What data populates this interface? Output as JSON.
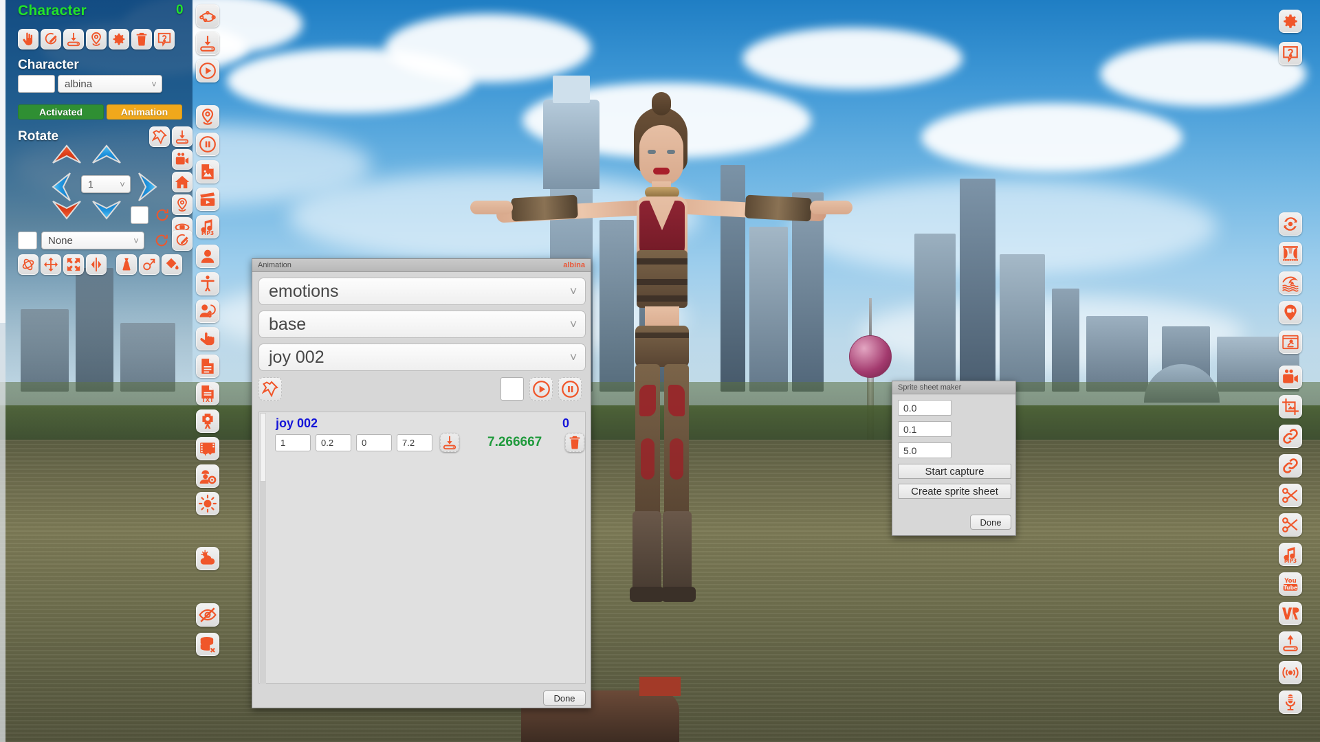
{
  "app": {
    "scene_name": "shanghai-skyline-background",
    "character_name": "albina"
  },
  "left_panel": {
    "title": "Character",
    "count": "0",
    "section_label": "Character",
    "character_value": "albina",
    "activated_label": "Activated",
    "animation_label": "Animation",
    "rotate_label": "Rotate",
    "rotate_step": "1",
    "morph_value": "None",
    "toolbar_icons": [
      {
        "name": "select-hand-icon"
      },
      {
        "name": "edit-pencil-icon"
      },
      {
        "name": "save-download-icon"
      },
      {
        "name": "place-marker-icon"
      },
      {
        "name": "settings-gear-icon"
      },
      {
        "name": "delete-trash-icon"
      },
      {
        "name": "help-question-icon"
      }
    ],
    "side_icons": [
      {
        "name": "pin-icon"
      },
      {
        "name": "save-download-icon"
      },
      {
        "name": "video-camera-icon"
      },
      {
        "name": "home-icon"
      },
      {
        "name": "place-marker-icon"
      },
      {
        "name": "orbit-camera-icon"
      },
      {
        "name": "reload-icon"
      },
      {
        "name": "edit-pencil-icon"
      }
    ],
    "transform_icons": [
      {
        "name": "rotate-3d-icon"
      },
      {
        "name": "move-icon"
      },
      {
        "name": "scale-icon"
      },
      {
        "name": "mirror-icon"
      },
      {
        "name": "clothing-dress-icon"
      },
      {
        "name": "attach-object-icon"
      },
      {
        "name": "paint-bucket-icon"
      }
    ]
  },
  "tool_rail": {
    "icons": [
      {
        "name": "path-nodes-icon"
      },
      {
        "name": "save-download-icon"
      },
      {
        "name": "play-circle-icon"
      },
      {
        "name": "place-marker-icon"
      },
      {
        "name": "pause-circle-icon"
      },
      {
        "name": "image-file-icon"
      },
      {
        "name": "clapperboard-icon"
      },
      {
        "name": "mp3-music-icon"
      },
      {
        "name": "avatar-person-icon"
      },
      {
        "name": "pose-figure-icon"
      },
      {
        "name": "character-swap-icon"
      },
      {
        "name": "hand-gesture-icon"
      },
      {
        "name": "document-icon"
      },
      {
        "name": "text-file-txt-icon"
      },
      {
        "name": "target-aim-icon"
      },
      {
        "name": "film-effects-icon"
      },
      {
        "name": "worker-settings-icon"
      },
      {
        "name": "sun-light-icon"
      },
      {
        "name": "weather-cloud-icon"
      },
      {
        "name": "hide-eye-icon"
      },
      {
        "name": "delete-database-icon"
      }
    ]
  },
  "right_rail": {
    "icons": [
      {
        "name": "settings-gear-icon"
      },
      {
        "name": "help-question-icon"
      },
      {
        "name": "refresh-sync-icon"
      },
      {
        "name": "stage-curtain-icon"
      },
      {
        "name": "water-wave-icon"
      },
      {
        "name": "video-location-icon"
      },
      {
        "name": "animation-run-icon"
      },
      {
        "name": "video-camera-icon"
      },
      {
        "name": "crop-image-icon"
      },
      {
        "name": "link-icon"
      },
      {
        "name": "link-alt-icon"
      },
      {
        "name": "scissors-icon"
      },
      {
        "name": "scissors-alt-icon"
      },
      {
        "name": "mp3-music-icon"
      },
      {
        "name": "youtube-icon"
      },
      {
        "name": "vr-icon"
      },
      {
        "name": "upload-icon"
      },
      {
        "name": "broadcast-signal-icon"
      },
      {
        "name": "microphone-icon"
      }
    ]
  },
  "animation_dialog": {
    "title": "Animation",
    "target": "albina",
    "category": "emotions",
    "subcategory": "base",
    "clip": "joy 002",
    "pin_icon": "pin-icon",
    "play_icon": "play-circle-icon",
    "pause_icon": "pause-circle-icon",
    "row": {
      "name": "joy 002",
      "index": "0",
      "fields": [
        "1",
        "0.2",
        "0",
        "7.2"
      ],
      "save_icon": "save-download-icon",
      "duration": "7.266667",
      "delete_icon": "delete-trash-icon"
    },
    "done_label": "Done"
  },
  "sprite_dialog": {
    "title": "Sprite sheet maker",
    "fields": [
      "0.0",
      "0.1",
      "5.0"
    ],
    "start_capture_label": "Start capture",
    "create_label": "Create sprite sheet",
    "done_label": "Done"
  },
  "colors": {
    "accent": "#f0562a",
    "panel_title": "#22e32b",
    "activated": "#2f8f33",
    "animation": "#f0a81b",
    "clip_blue": "#1414d8",
    "duration_green": "#1f9a3c"
  }
}
